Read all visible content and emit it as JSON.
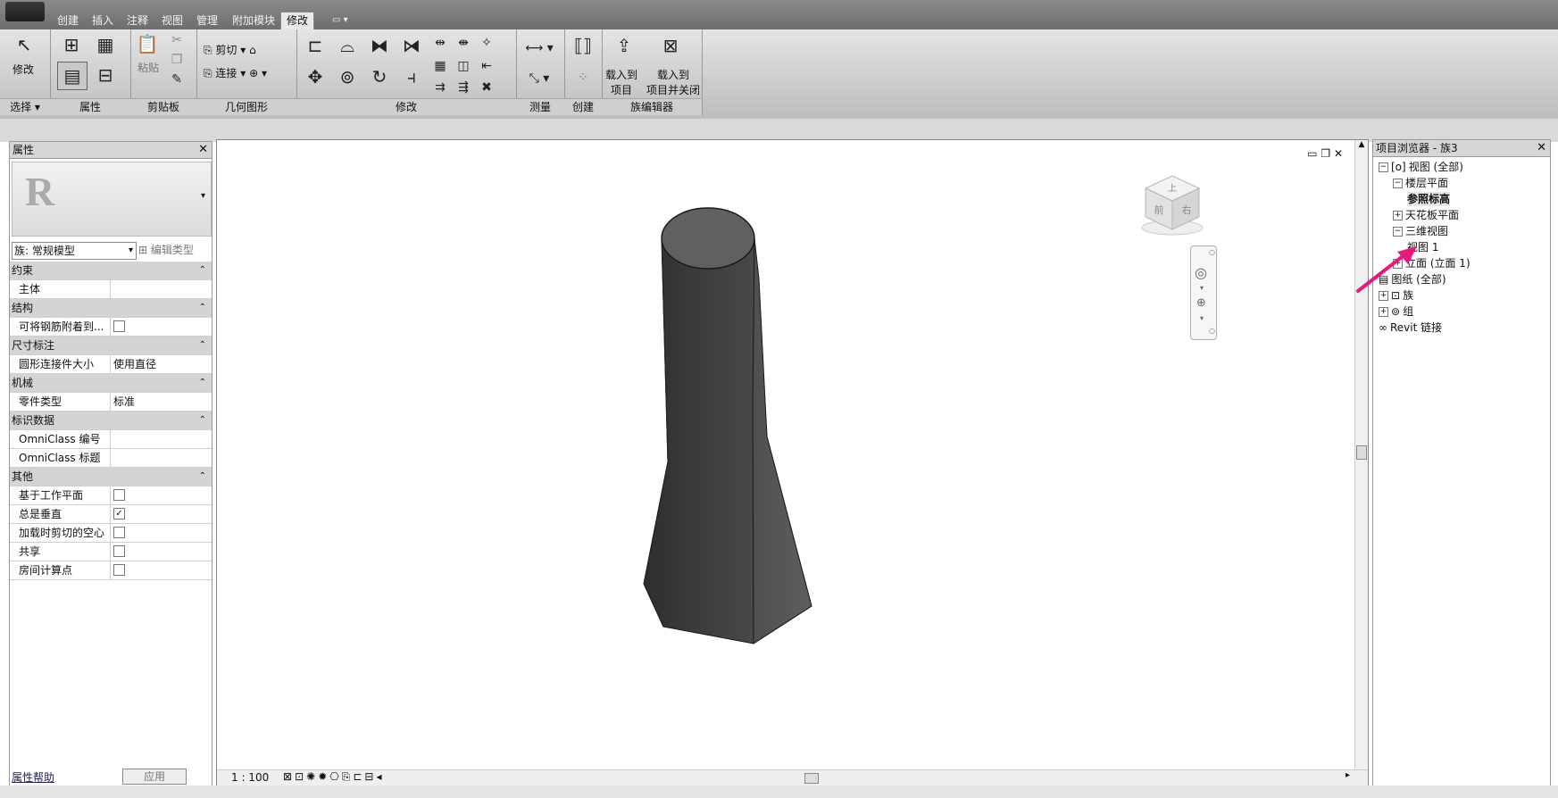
{
  "menu": {
    "tabs": [
      "创建",
      "插入",
      "注释",
      "视图",
      "管理",
      "附加模块",
      "修改"
    ],
    "active_tab": "修改"
  },
  "ribbon": {
    "panels": {
      "select": "选择 ▾",
      "properties": "属性",
      "clipboard": "剪贴板",
      "geometry": "几何图形",
      "modify": "修改",
      "measure": "测量",
      "create": "创建",
      "family_editor": "族编辑器"
    },
    "modify_button": "修改",
    "paste_label": "粘贴",
    "cut_label": "剪切",
    "join_label": "连接",
    "load_to_project_line1": "载入到",
    "load_to_project_line2": "项目",
    "load_close_line1": "载入到",
    "load_close_line2": "项目并关闭"
  },
  "properties": {
    "title": "属性",
    "type_selector": "族: 常规模型",
    "edit_type": "编辑类型",
    "help_link": "属性帮助",
    "apply_button": "应用",
    "rows": [
      {
        "cat": "约束"
      },
      {
        "k": "主体",
        "v": ""
      },
      {
        "cat": "结构"
      },
      {
        "k": "可将钢筋附着到...",
        "chk": false
      },
      {
        "cat": "尺寸标注"
      },
      {
        "k": "圆形连接件大小",
        "v": "使用直径"
      },
      {
        "cat": "机械"
      },
      {
        "k": "零件类型",
        "v": "标准"
      },
      {
        "cat": "标识数据"
      },
      {
        "k": "OmniClass 编号",
        "v": ""
      },
      {
        "k": "OmniClass 标题",
        "v": ""
      },
      {
        "cat": "其他"
      },
      {
        "k": "基于工作平面",
        "chk": false
      },
      {
        "k": "总是垂直",
        "chk": true
      },
      {
        "k": "加载时剪切的空心",
        "chk": false
      },
      {
        "k": "共享",
        "chk": false
      },
      {
        "k": "房间计算点",
        "chk": false
      }
    ]
  },
  "viewport": {
    "scale": "1 : 100",
    "viewcube_labels": {
      "top": "上",
      "front": "前",
      "right": "右"
    }
  },
  "browser": {
    "title": "项目浏览器 - 族3",
    "tree": [
      {
        "label": "视图 (全部)",
        "toggle": "⊟",
        "indent": 0
      },
      {
        "label": "楼层平面",
        "toggle": "⊟",
        "indent": 1
      },
      {
        "label": "参照标高",
        "toggle": "",
        "indent": 2,
        "bold": true
      },
      {
        "label": "天花板平面",
        "toggle": "⊞",
        "indent": 1
      },
      {
        "label": "三维视图",
        "toggle": "⊟",
        "indent": 1
      },
      {
        "label": "视图 1",
        "toggle": "",
        "indent": 2
      },
      {
        "label": "立面 (立面 1)",
        "toggle": "⊞",
        "indent": 1
      },
      {
        "label": "图纸 (全部)",
        "toggle": "",
        "indent": 0
      },
      {
        "label": "族",
        "toggle": "⊞",
        "indent": 0
      },
      {
        "label": "组",
        "toggle": "⊞",
        "indent": 0
      },
      {
        "label": "Revit 链接",
        "toggle": "",
        "indent": 0
      }
    ]
  },
  "colors": {
    "annotation_arrow": "#e8197d"
  }
}
